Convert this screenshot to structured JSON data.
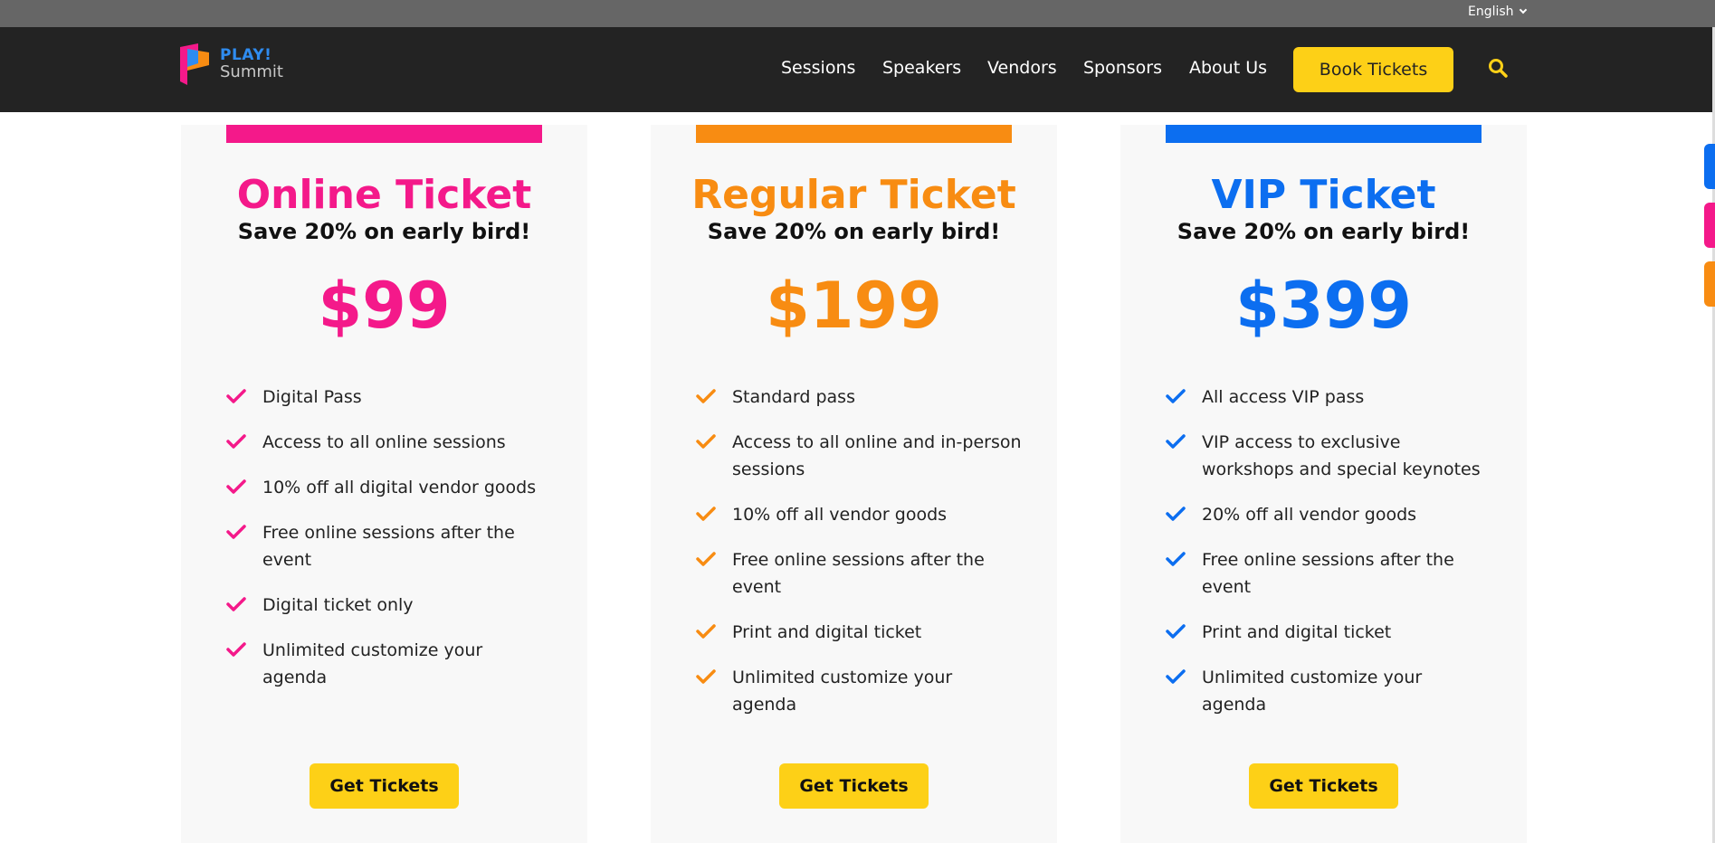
{
  "topbar": {
    "language_label": "English"
  },
  "header": {
    "logo_top": "PLAY!",
    "logo_bottom": "Summit",
    "nav": [
      {
        "label": "Sessions"
      },
      {
        "label": "Speakers"
      },
      {
        "label": "Vendors"
      },
      {
        "label": "Sponsors"
      },
      {
        "label": "About Us"
      }
    ],
    "book_label": "Book Tickets"
  },
  "colors": {
    "online": "#f4198a",
    "regular": "#f88c12",
    "vip": "#0c6ef0",
    "button": "#fdd017",
    "header_bg": "#232323",
    "topbar_bg": "#666666"
  },
  "tickets": [
    {
      "title": "Online Ticket",
      "subtitle": "Save 20% on early bird!",
      "price": "$99",
      "features": [
        "Digital Pass",
        "Access to all online sessions",
        "10% off all digital vendor goods",
        "Free online sessions after the event",
        "Digital ticket only",
        "Unlimited customize your agenda"
      ],
      "button_label": "Get Tickets"
    },
    {
      "title": "Regular Ticket",
      "subtitle": "Save 20% on early bird!",
      "price": "$199",
      "features": [
        "Standard pass",
        "Access to all online and in-person sessions",
        "10% off all vendor goods",
        "Free online sessions after the event",
        "Print and digital ticket",
        "Unlimited customize your agenda"
      ],
      "button_label": "Get Tickets"
    },
    {
      "title": "VIP Ticket",
      "subtitle": "Save 20% on early bird!",
      "price": "$399",
      "features": [
        "All access VIP pass",
        "VIP access to exclusive workshops and special keynotes",
        "20% off all vendor goods",
        "Free online sessions after the event",
        "Print and digital ticket",
        "Unlimited customize your agenda"
      ],
      "button_label": "Get Tickets"
    }
  ]
}
